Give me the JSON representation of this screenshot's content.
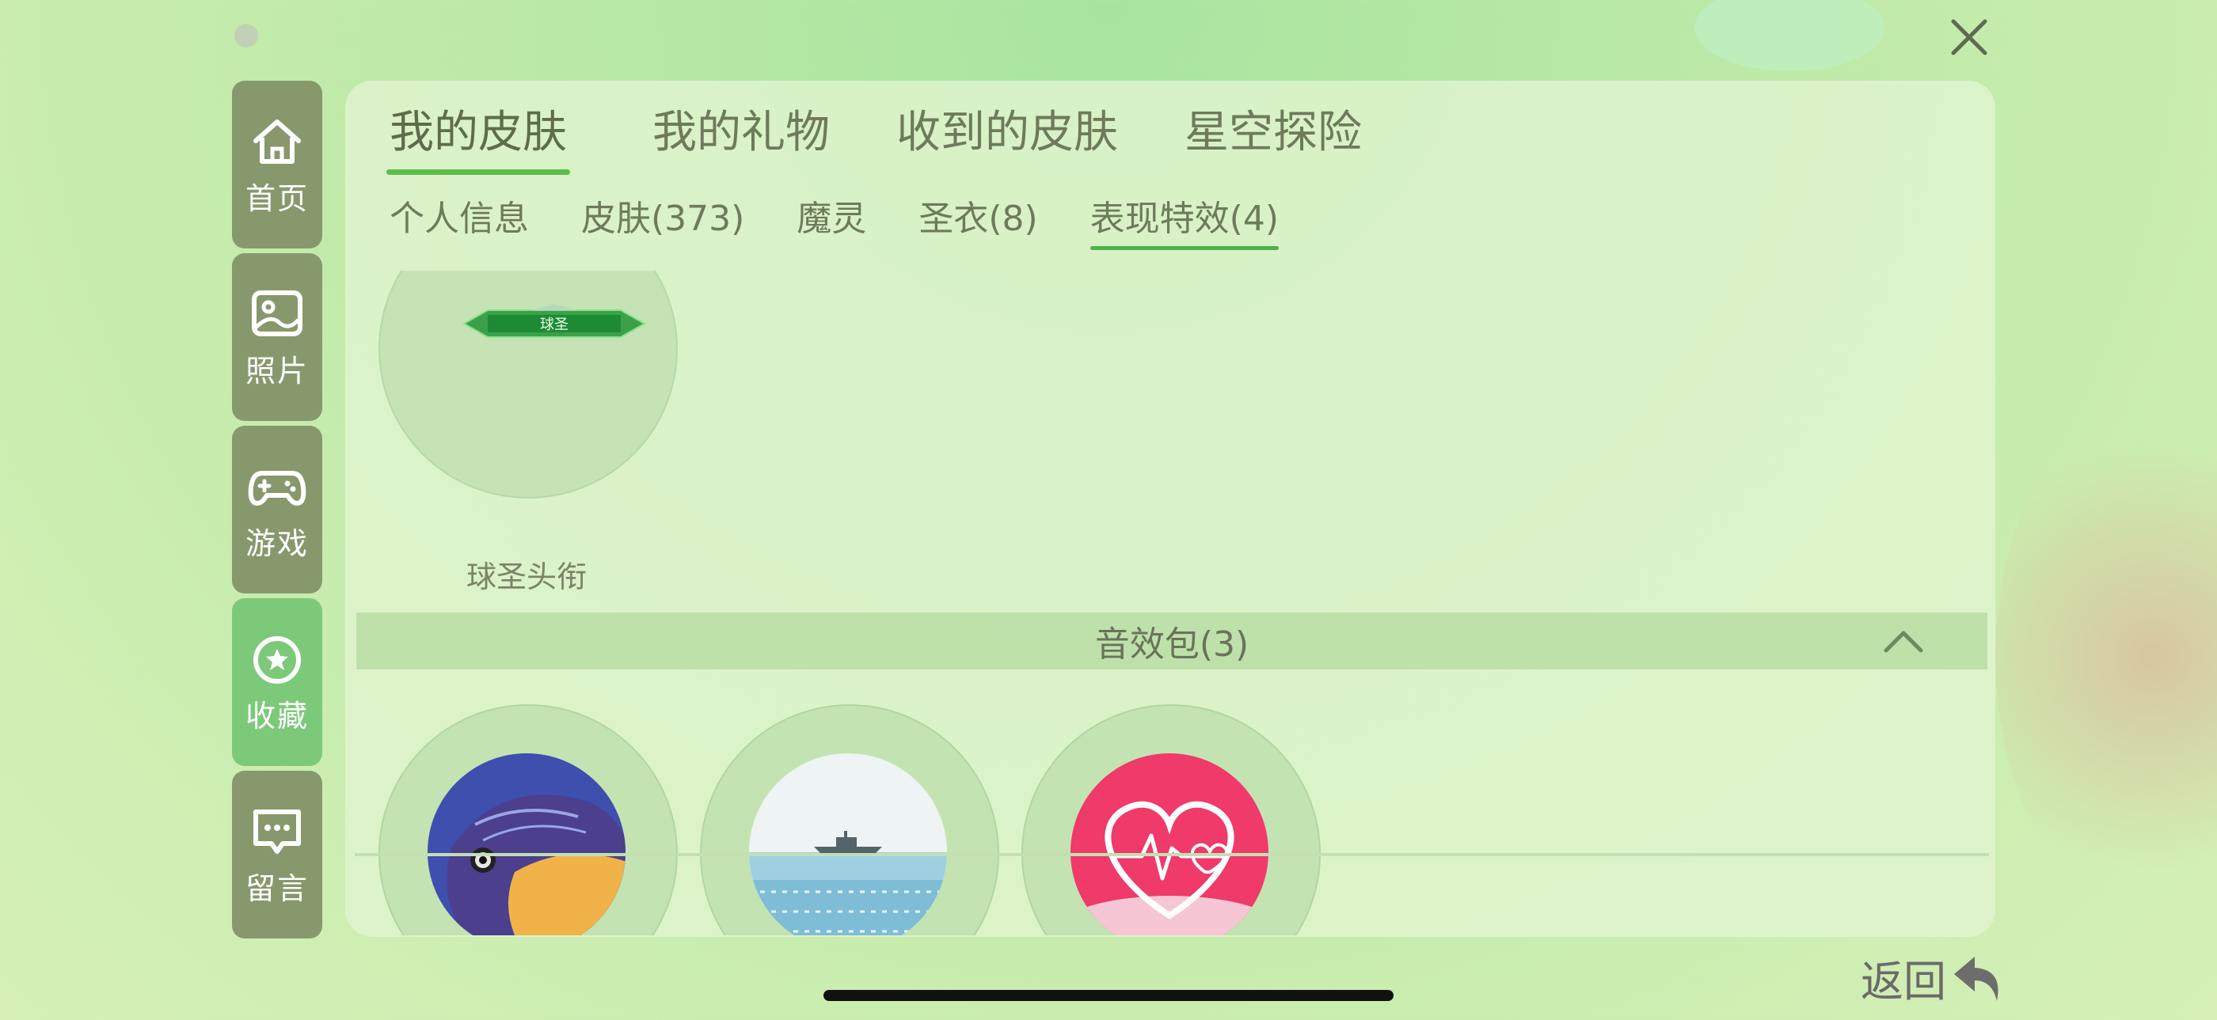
{
  "window": {
    "close_icon": "close-icon"
  },
  "sidebar": {
    "items": [
      {
        "label": "首页",
        "icon": "home-icon",
        "active": false
      },
      {
        "label": "照片",
        "icon": "photo-icon",
        "active": false
      },
      {
        "label": "游戏",
        "icon": "gamepad-icon",
        "active": false
      },
      {
        "label": "收藏",
        "icon": "star-icon",
        "active": true
      },
      {
        "label": "留言",
        "icon": "message-icon",
        "active": false
      }
    ]
  },
  "tabs": [
    {
      "label": "我的皮肤",
      "active": true
    },
    {
      "label": "我的礼物",
      "active": false
    },
    {
      "label": "收到的皮肤",
      "active": false
    },
    {
      "label": "星空探险",
      "active": false
    }
  ],
  "subtabs": [
    {
      "label": "个人信息",
      "active": false
    },
    {
      "label": "皮肤(373)",
      "active": false
    },
    {
      "label": "魔灵",
      "active": false
    },
    {
      "label": "圣衣(8)",
      "active": false
    },
    {
      "label": "表现特效(4)",
      "active": true
    }
  ],
  "title_badge": {
    "name": "球圣头衔",
    "badge_text": "球圣"
  },
  "sound_section": {
    "title": "音效包(3)",
    "expanded": true,
    "items": [
      {
        "image": "fish"
      },
      {
        "image": "ship-on-sea"
      },
      {
        "image": "heartbeat"
      }
    ]
  },
  "back_button": {
    "label": "返回",
    "icon": "back-arrow-icon"
  },
  "colors": {
    "accent": "#5cbf4c",
    "nav_bg": "#87996c",
    "nav_active_bg": "#7dc97a"
  }
}
